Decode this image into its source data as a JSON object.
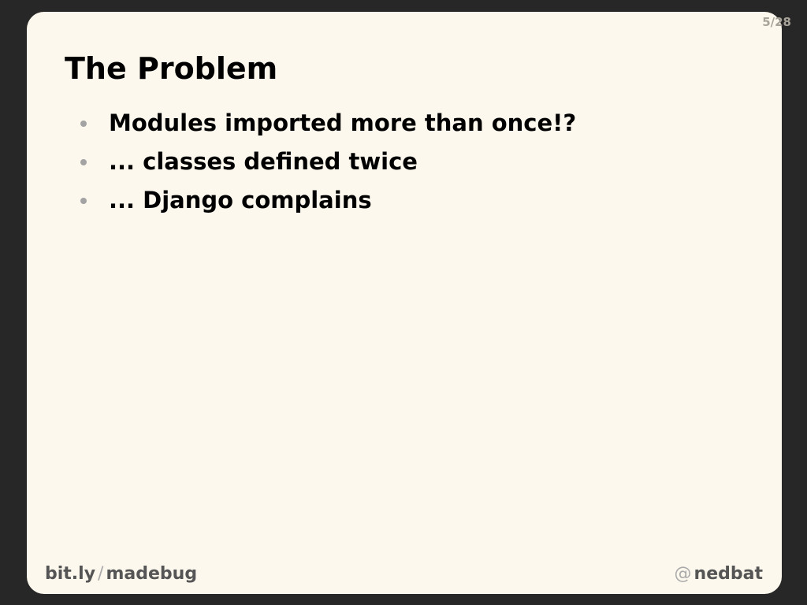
{
  "slide": {
    "counter": "5/28",
    "title": "The Problem",
    "bullets": [
      "Modules imported more than once!?",
      "... classes defined twice",
      "... Django complains"
    ]
  },
  "footer": {
    "left_part1": "bit.ly",
    "left_separator": "/",
    "left_part2": "madebug",
    "right_at": "@",
    "right_handle": "nedbat"
  }
}
